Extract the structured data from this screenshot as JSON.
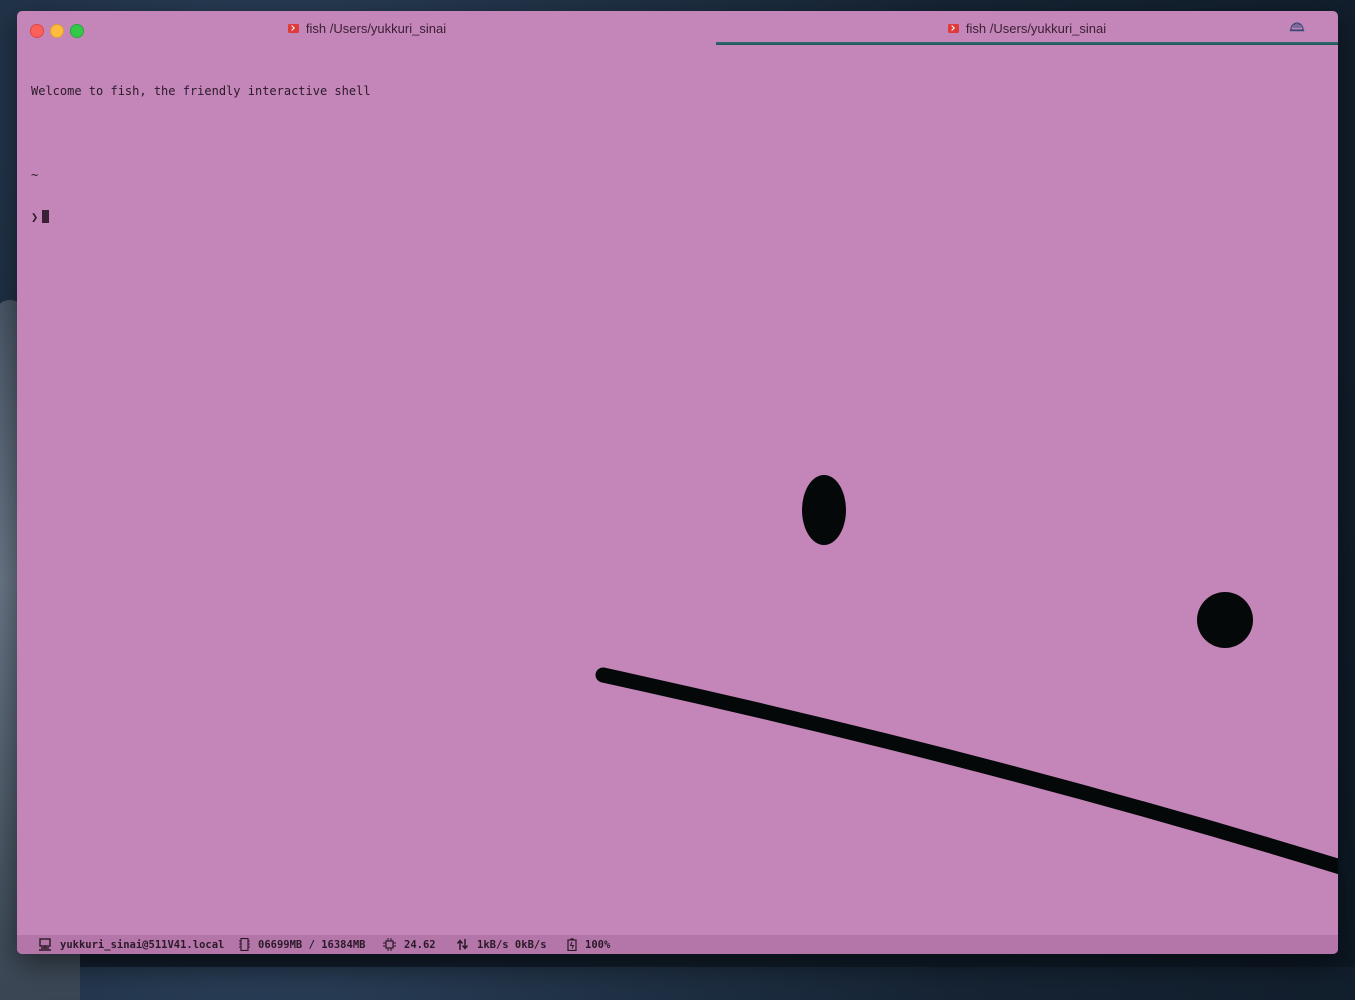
{
  "window": {
    "tabs": [
      {
        "label": "fish /Users/yukkuri_sinai",
        "active": false
      },
      {
        "label": "fish /Users/yukkuri_sinai",
        "active": true
      }
    ]
  },
  "terminal": {
    "lines": [
      "Welcome to fish, the friendly interactive shell",
      "",
      "~",
      "❯"
    ]
  },
  "statusbar": {
    "host": "yukkuri_sinai@511V41.local",
    "memory": "06699MB / 16384MB",
    "cpu": "24.62",
    "network": "1kB/s 0kB/s",
    "battery": "100%"
  },
  "colors": {
    "background": "#c485b9",
    "statusbar": "#b476a9",
    "drawing": "#050808",
    "tab_active_underline": "#2d6e72"
  },
  "icons": {
    "tab": "terminal-icon",
    "corner": "hat-icon",
    "host": "computer-icon",
    "memory": "memory-icon",
    "cpu": "cpu-icon",
    "network": "network-arrows-icon",
    "battery": "battery-icon"
  }
}
